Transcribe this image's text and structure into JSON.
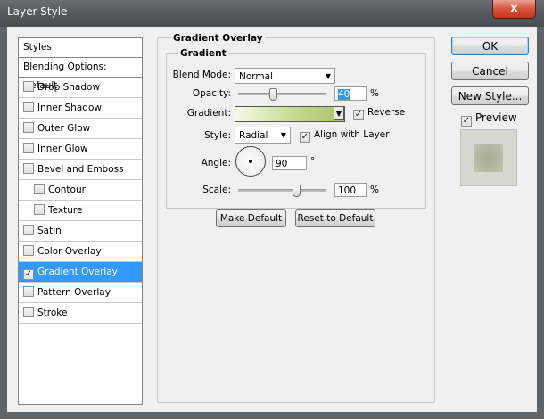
{
  "window": {
    "title": "Layer Style",
    "close_glyph": "x"
  },
  "styles_panel": {
    "header": "Styles",
    "blending_options": "Blending Options: Default",
    "items": [
      {
        "label": "Drop Shadow",
        "checked": false,
        "sub": false
      },
      {
        "label": "Inner Shadow",
        "checked": false,
        "sub": false
      },
      {
        "label": "Outer Glow",
        "checked": false,
        "sub": false
      },
      {
        "label": "Inner Glow",
        "checked": false,
        "sub": false
      },
      {
        "label": "Bevel and Emboss",
        "checked": false,
        "sub": false
      },
      {
        "label": "Contour",
        "checked": false,
        "sub": true
      },
      {
        "label": "Texture",
        "checked": false,
        "sub": true
      },
      {
        "label": "Satin",
        "checked": false,
        "sub": false
      },
      {
        "label": "Color Overlay",
        "checked": false,
        "sub": false
      },
      {
        "label": "Gradient Overlay",
        "checked": true,
        "sub": false,
        "selected": true
      },
      {
        "label": "Pattern Overlay",
        "checked": false,
        "sub": false
      },
      {
        "label": "Stroke",
        "checked": false,
        "sub": false
      }
    ]
  },
  "gradient_overlay": {
    "section_title": "Gradient Overlay",
    "group_title": "Gradient",
    "blend_mode": {
      "label": "Blend Mode:",
      "value": "Normal"
    },
    "opacity": {
      "label": "Opacity:",
      "value": "40",
      "unit": "%",
      "level": 40
    },
    "gradient": {
      "label": "Gradient:",
      "reverse_label": "Reverse",
      "reverse_checked": true
    },
    "style": {
      "label": "Style:",
      "value": "Radial",
      "align_label": "Align with Layer",
      "align_checked": true
    },
    "angle": {
      "label": "Angle:",
      "value": "90",
      "unit": "°"
    },
    "scale": {
      "label": "Scale:",
      "value": "100",
      "unit": "%",
      "level": 100
    },
    "make_default": "Make Default",
    "reset_default": "Reset to Default"
  },
  "right_panel": {
    "ok": "OK",
    "cancel": "Cancel",
    "new_style": "New Style...",
    "preview_label": "Preview",
    "preview_checked": true
  },
  "colors": {
    "selection": "#3399ff",
    "gradient_start": "#f6f8ea",
    "gradient_end": "#a9c46a"
  }
}
